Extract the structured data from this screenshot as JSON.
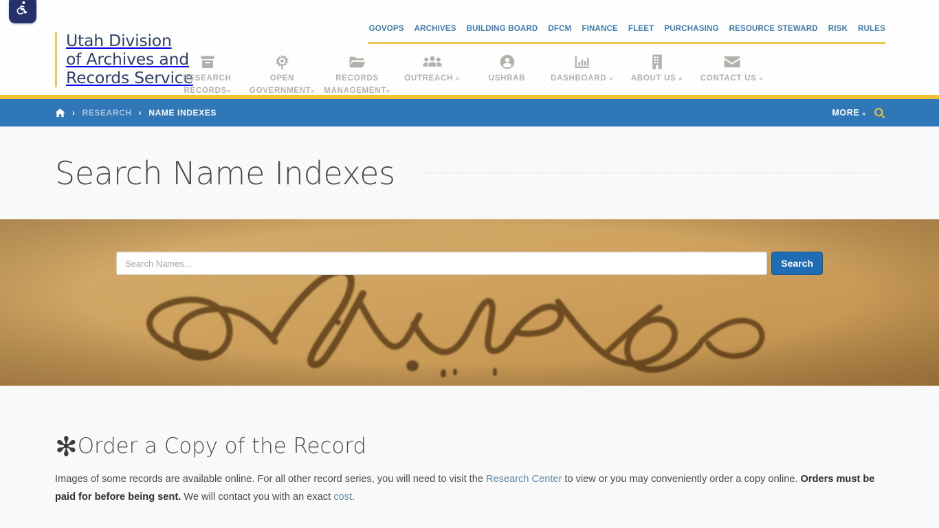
{
  "accessibility": {
    "icon": "wheelchair-accessibility-icon",
    "label": "Accessibility Options"
  },
  "header": {
    "logo_text": "Utah Division\nof Archives and\nRecords Service",
    "accent_color": "#edc951",
    "logo_color": "#31406b",
    "agency_links": [
      {
        "label": "GOVOPS"
      },
      {
        "label": "ARCHIVES"
      },
      {
        "label": "BUILDING BOARD"
      },
      {
        "label": "DFCM"
      },
      {
        "label": "FINANCE"
      },
      {
        "label": "FLEET"
      },
      {
        "label": "PURCHASING"
      },
      {
        "label": "RESOURCE STEWARD"
      },
      {
        "label": "RISK"
      },
      {
        "label": "RULES"
      }
    ],
    "icon_nav": [
      {
        "label": "RESEARCH\nRECORDS",
        "icon": "archive-box-icon",
        "has_caret": true
      },
      {
        "label": "OPEN\nGOVERNMENT",
        "icon": "gear-sun-icon",
        "has_caret": true
      },
      {
        "label": "RECORDS\nMANAGEMENT",
        "icon": "folder-open-icon",
        "has_caret": true
      },
      {
        "label": "OUTREACH",
        "icon": "people-group-icon",
        "has_caret": true
      },
      {
        "label": "USHRAB",
        "icon": "user-circle-icon",
        "has_caret": false
      },
      {
        "label": "DASHBOARD",
        "icon": "bar-chart-icon",
        "has_caret": true
      },
      {
        "label": "ABOUT US",
        "icon": "building-icon",
        "has_caret": true
      },
      {
        "label": "CONTACT US",
        "icon": "envelope-icon",
        "has_caret": true
      }
    ],
    "caret_glyph": "»"
  },
  "breadcrumb": {
    "bar_color": "#2f77b7",
    "home_icon": "home-icon",
    "separator": "›",
    "items": [
      {
        "label": "RESEARCH",
        "current": false
      },
      {
        "label": "NAME INDEXES",
        "current": true
      }
    ],
    "more_label": "MORE",
    "more_caret": "»",
    "search_icon": "search-icon",
    "search_icon_color": "#f2c230"
  },
  "page": {
    "title": "Search Name Indexes"
  },
  "hero": {
    "image_description": "aged parchment with handwritten cursive word Index",
    "search": {
      "placeholder": "Search Names...",
      "value": "",
      "button_label": "Search",
      "button_color": "#1f6bb4"
    }
  },
  "main": {
    "section": {
      "bullet": "✻",
      "heading": "Order a Copy of the Record",
      "paragraph": {
        "p1": "Images of some records are available online. For all other record series, you will need to visit the ",
        "link1": "Research Center",
        "p2": " to view or you may conveniently order a copy online. ",
        "strong1": "Orders must be paid for before being sent.",
        "p3": " We will contact you with an exact ",
        "link2": "cost",
        "p4": "."
      }
    }
  }
}
